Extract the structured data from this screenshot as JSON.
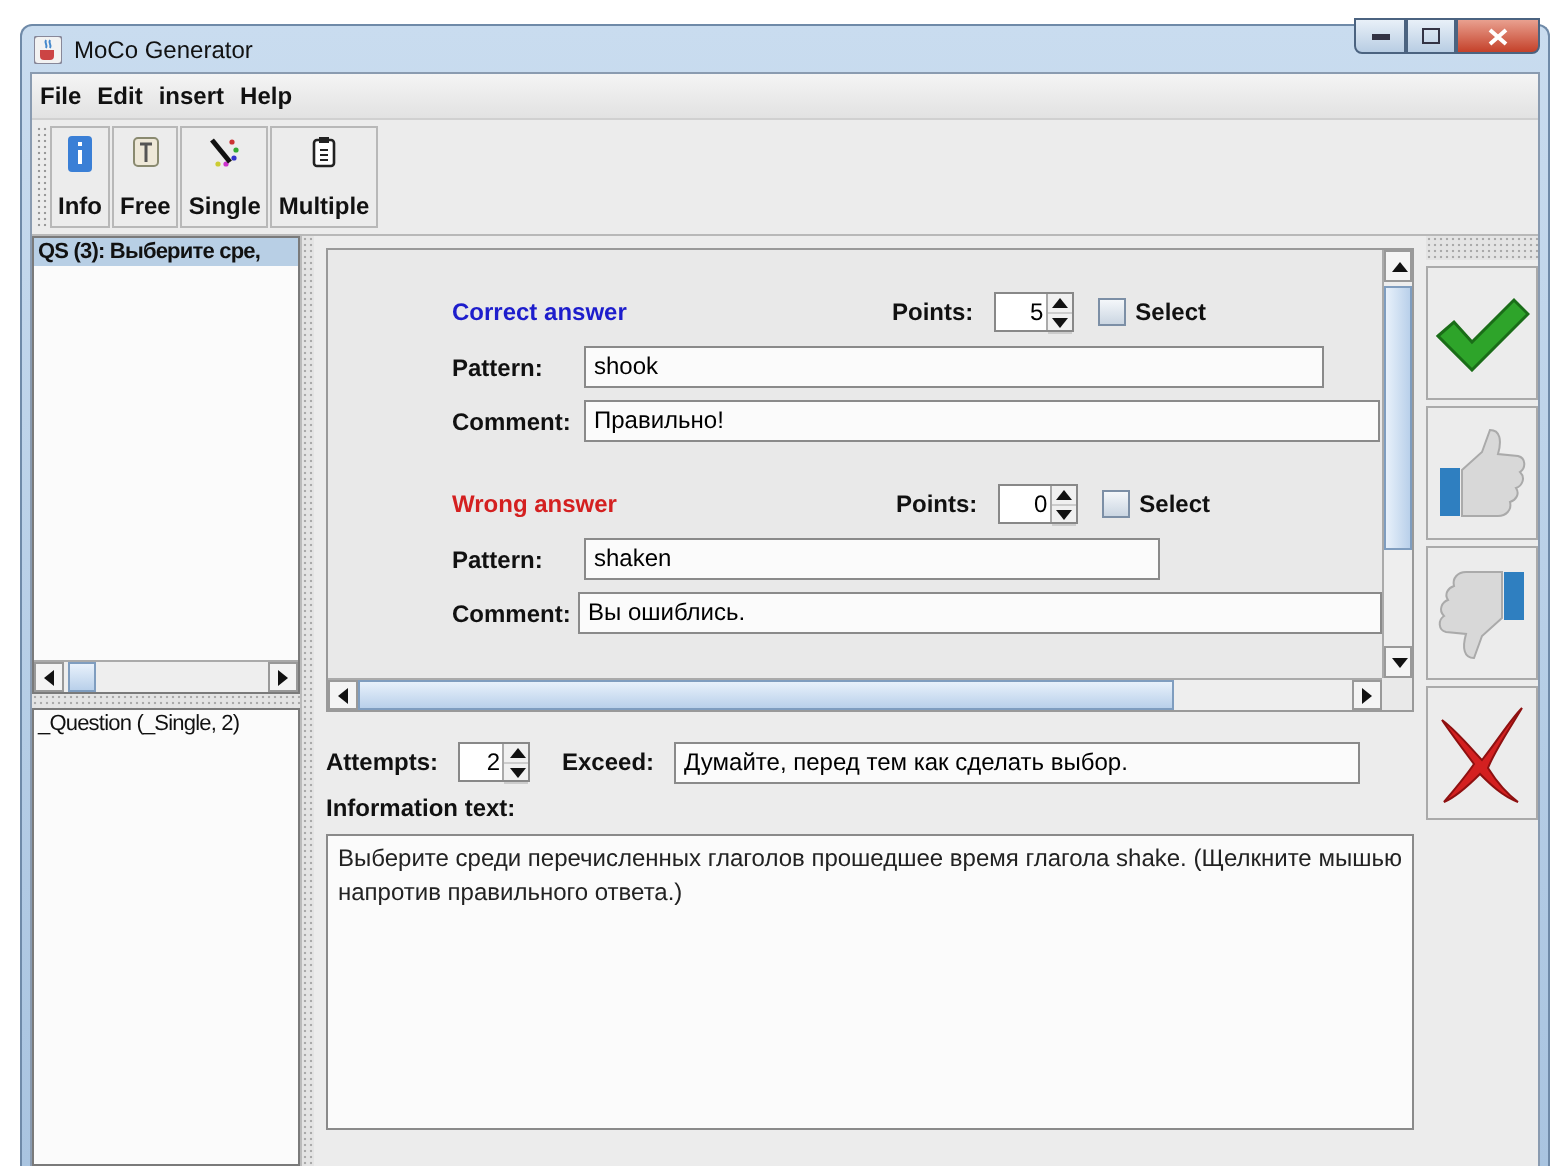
{
  "window": {
    "title": "MoCo Generator"
  },
  "menu": [
    "File",
    "Edit",
    "insert",
    "Help"
  ],
  "toolbar": [
    {
      "kind": "info",
      "label": "Info"
    },
    {
      "kind": "free",
      "label": "Free"
    },
    {
      "kind": "single",
      "label": "Single"
    },
    {
      "kind": "multiple",
      "label": "Multiple"
    }
  ],
  "question_list": {
    "items": [
      {
        "label": "QS (3): Выберите сре,",
        "selected": true
      }
    ]
  },
  "element_list": {
    "items": [
      {
        "label": "_Question (_Single, 2)",
        "selected": false
      }
    ]
  },
  "answers": [
    {
      "kind": "correct",
      "title": "Correct answer",
      "points_label": "Points:",
      "points": "5",
      "select_label": "Select",
      "checked": false,
      "pattern_label": "Pattern:",
      "pattern": "shook",
      "comment_label": "Comment:",
      "comment": "Правильно!"
    },
    {
      "kind": "wrong",
      "title": "Wrong answer",
      "points_label": "Points:",
      "points": "0",
      "select_label": "Select",
      "checked": false,
      "pattern_label": "Pattern:",
      "pattern": "shaken",
      "comment_label": "Comment:",
      "comment": "Вы ошиблись."
    }
  ],
  "attempts": {
    "label": "Attempts:",
    "value": "2"
  },
  "exceed": {
    "label": "Exceed:",
    "value": "Думайте, перед тем как сделать выбор."
  },
  "information": {
    "label": "Information text:",
    "text": "Выберите среди перечисленных глаголов  прошедшее время глагола shake. (Щелкните мышью напротив правильного ответа.)"
  },
  "side_buttons": [
    {
      "kind": "accept"
    },
    {
      "kind": "thumbs_up"
    },
    {
      "kind": "thumbs_down"
    },
    {
      "kind": "reject"
    }
  ]
}
